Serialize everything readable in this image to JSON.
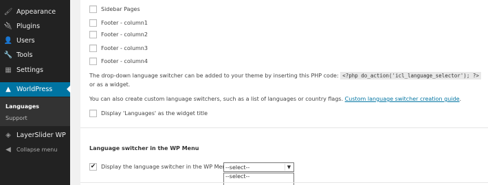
{
  "sidebar": {
    "items": [
      {
        "label": "Appearance",
        "icon": "paintbrush-icon"
      },
      {
        "label": "Plugins",
        "icon": "plug-icon"
      },
      {
        "label": "Users",
        "icon": "user-icon"
      },
      {
        "label": "Tools",
        "icon": "wrench-icon"
      },
      {
        "label": "Settings",
        "icon": "settings-icon"
      },
      {
        "label": "WorldPress",
        "icon": "wpml-icon"
      }
    ],
    "submenu": [
      {
        "label": "Languages"
      },
      {
        "label": "Support"
      }
    ],
    "after": [
      {
        "label": "LayerSlider WP",
        "icon": "layers-icon"
      },
      {
        "label": "Collapse menu",
        "icon": "collapse-icon"
      }
    ],
    "active_color": "#0074a2"
  },
  "main": {
    "widget_options": [
      {
        "label": "Sidebar Pages",
        "checked": false
      },
      {
        "label": "Footer - column1",
        "checked": false
      },
      {
        "label": "Footer - column2",
        "checked": false
      },
      {
        "label": "Footer - column3",
        "checked": false
      },
      {
        "label": "Footer - column4",
        "checked": false
      }
    ],
    "php_text_before": "The drop-down language switcher can be added to your theme by inserting this PHP code:",
    "php_code": "<?php do_action('icl_language_selector'); ?>",
    "php_text_after": "or as a widget.",
    "custom_text": "You can also create custom language switchers, such as a list of languages or country flags.",
    "custom_link": "Custom language switcher creation guide",
    "custom_after": ".",
    "widget_title_option": {
      "label": "Display 'Languages' as the widget title",
      "checked": false
    },
    "wp_menu_section_title": "Language switcher in the WP Menu",
    "wp_menu_option": {
      "label": "Display the language switcher in the WP Menu",
      "checked": true
    },
    "menu_select": {
      "value": "--select--",
      "options": [
        "--select--"
      ]
    }
  }
}
